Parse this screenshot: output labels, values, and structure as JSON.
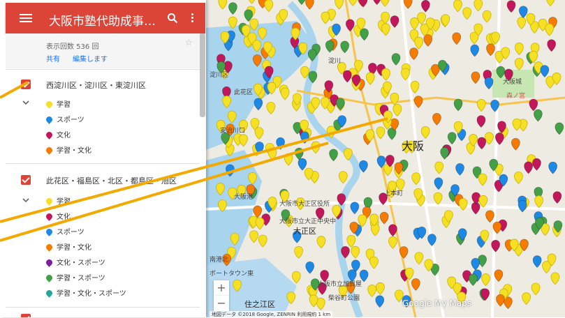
{
  "header": {
    "title": "大阪市塾代助成事業教..."
  },
  "info": {
    "views": "表示回数 536 回",
    "share": "共有",
    "edit": "編集します"
  },
  "layers": [
    {
      "name": "西淀川区・淀川区・東淀川区",
      "items": [
        {
          "label": "学習",
          "color": "#f6e026"
        },
        {
          "label": "スポーツ",
          "color": "#1e88e5"
        },
        {
          "label": "文化",
          "color": "#c2185b"
        },
        {
          "label": "学習・文化",
          "color": "#f57c00"
        }
      ]
    },
    {
      "name": "此花区・福島区・北区・都島区・旭区",
      "items": [
        {
          "label": "学習",
          "color": "#f6e026"
        },
        {
          "label": "文化",
          "color": "#c2185b"
        },
        {
          "label": "スポーツ",
          "color": "#1e88e5"
        },
        {
          "label": "学習・文化",
          "color": "#f57c00"
        },
        {
          "label": "文化・スポーツ",
          "color": "#7b1fa2"
        },
        {
          "label": "学習・スポーツ",
          "color": "#43a047"
        },
        {
          "label": "学習・文化・スポーツ",
          "color": "#26a69a"
        }
      ]
    }
  ],
  "map": {
    "labels": {
      "nishiyodogawa": "淀川区",
      "yodogawa": "淀川",
      "konohana": "此花区",
      "ajikawa": "安治川口",
      "osaka": "大阪",
      "osakajo": "大阪城",
      "morinomiya": "森ノ宮",
      "minato": "大阪港",
      "taisho": "大正区",
      "taisho_office": "大阪市大正区役所",
      "suminoe": "住之江区",
      "nankou": "南港北",
      "port_town": "ポートタウン東",
      "tengachaya": "大阪市立加賀屋",
      "kagaya": "柴谷町公園",
      "nishi": "大阪市立大正中央中",
      "uehonmachi": "上本町"
    },
    "attribution": "地図データ ©2018 Google, ZENRIN   利用規約   1 km",
    "watermark": "Google My Maps",
    "zoom_in": "+",
    "zoom_out": "−"
  }
}
